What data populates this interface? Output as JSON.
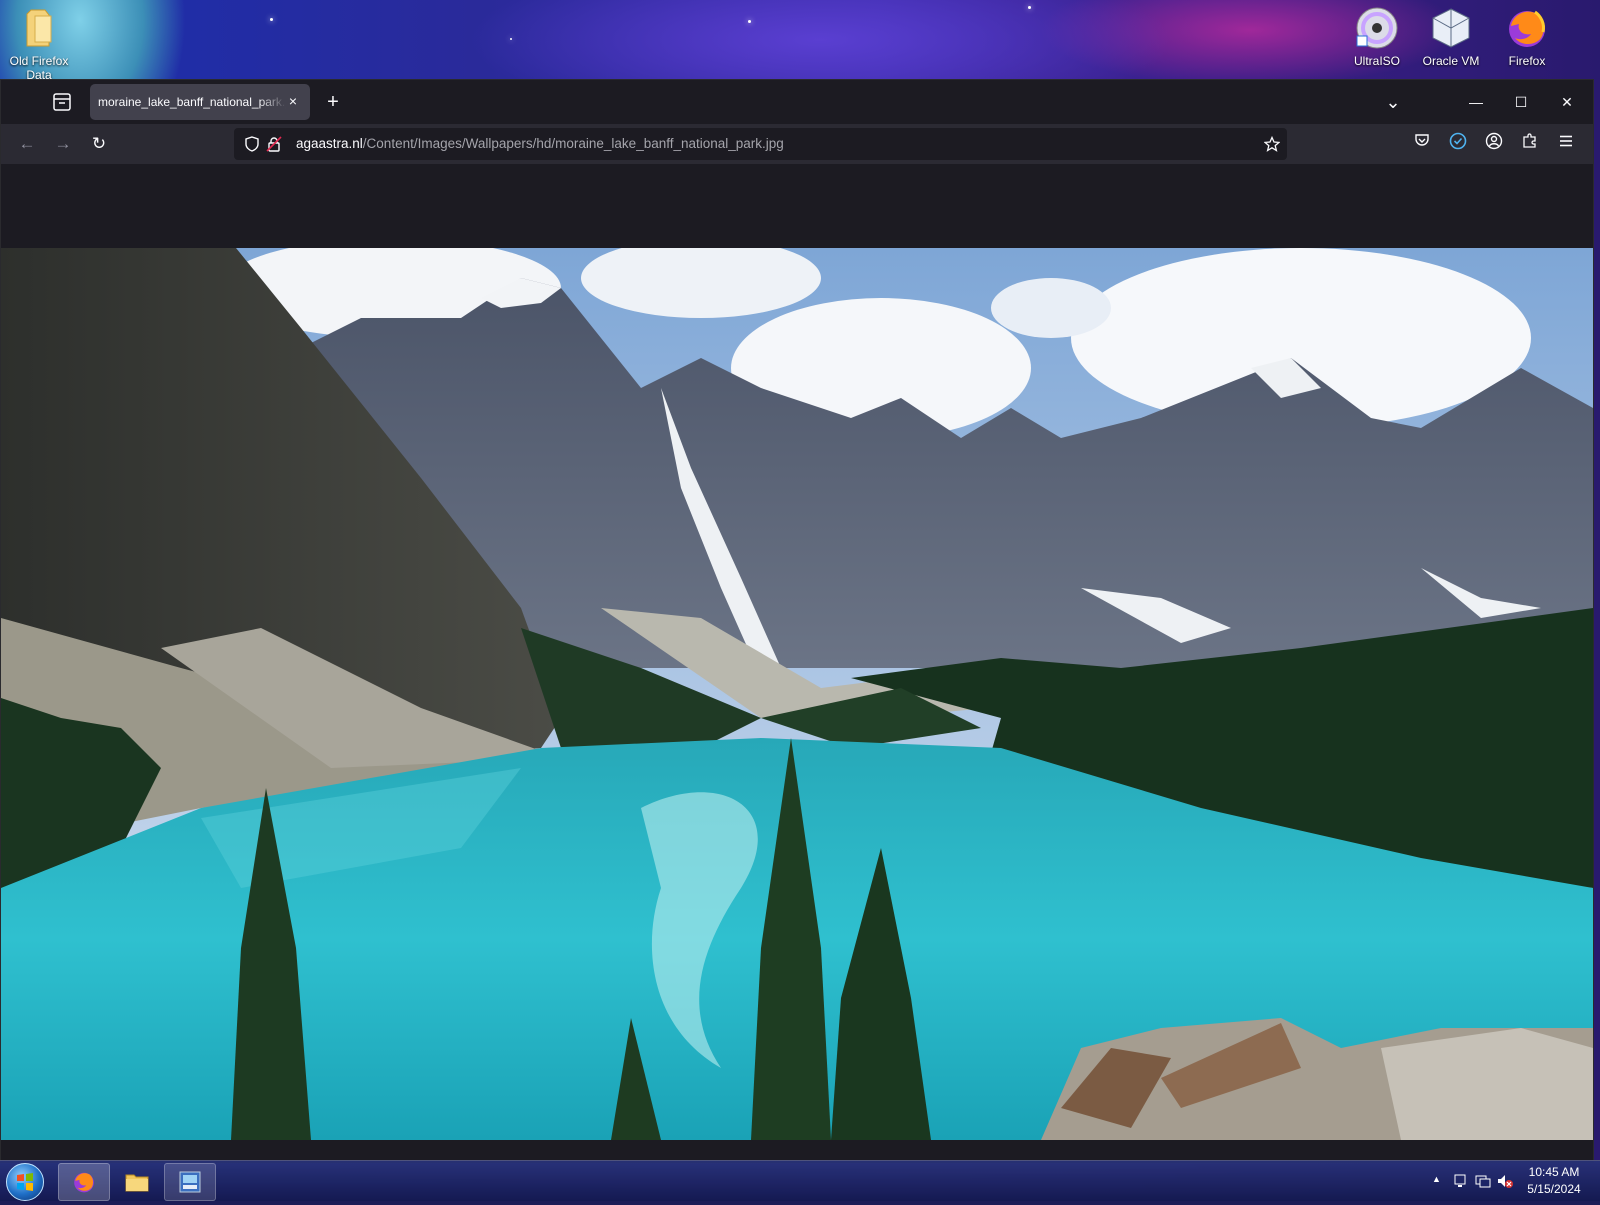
{
  "desktop": {
    "icons": [
      {
        "label": "Old Firefox Data",
        "icon": "folder-icon"
      },
      {
        "label": "UltraISO",
        "icon": "disc-icon"
      },
      {
        "label": "Oracle VM VirtualBox",
        "icon": "virtualbox-icon"
      },
      {
        "label": "Firefox",
        "icon": "firefox-icon"
      }
    ]
  },
  "browser": {
    "tab": {
      "title": "moraine_lake_banff_national_park.jpg",
      "close_icon": "×"
    },
    "newtab_label": "+",
    "window_controls": {
      "list_all_tabs": "⌄",
      "minimize": "—",
      "maximize": "☐",
      "close": "✕"
    },
    "nav": {
      "back": "←",
      "forward": "→",
      "reload": "↻"
    },
    "url": {
      "domain": "agaastra.nl",
      "path": "/Content/Images/Wallpapers/hd/moraine_lake_banff_national_park.jpg"
    }
  },
  "taskbar": {
    "items": [
      {
        "name": "firefox-taskbar-item",
        "icon": "firefox-icon",
        "active": true
      },
      {
        "name": "file-explorer-taskbar-item",
        "icon": "folder-icon",
        "active": false
      },
      {
        "name": "app-2016-taskbar-item",
        "icon": "app-icon",
        "active": false
      }
    ],
    "clock": {
      "time": "10:45 AM",
      "date": "5/15/2024"
    },
    "tray_up_arrow": "▲"
  },
  "colors": {
    "tab_active": "#42414d",
    "toolbar": "#2b2a33",
    "frame": "#1c1b22",
    "lake": "#2fc0cf",
    "accent_blue": "#4fb3f0"
  }
}
